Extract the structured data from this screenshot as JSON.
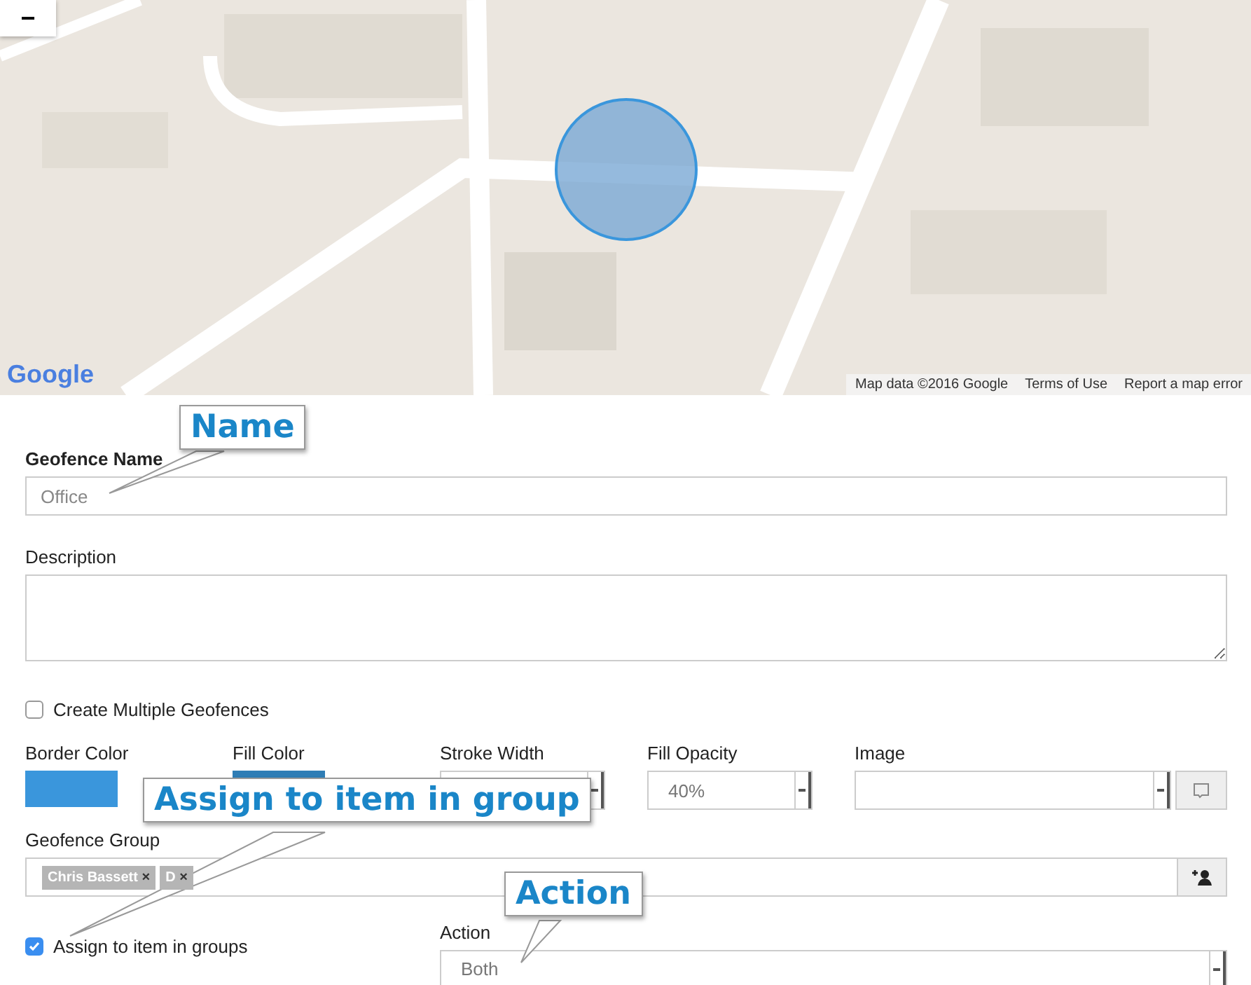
{
  "map": {
    "zoom_out": "−",
    "logo": "Google",
    "attribution": [
      "Map data ©2016 Google",
      "Terms of Use",
      "Report a map error"
    ]
  },
  "form": {
    "name": {
      "label": "Geofence Name",
      "placeholder": "Office"
    },
    "description": {
      "label": "Description"
    },
    "multiple": {
      "label": "Create Multiple Geofences",
      "checked": false
    },
    "border_color": {
      "label": "Border Color",
      "color": "#3a96dc"
    },
    "fill_color": {
      "label": "Fill Color",
      "color": "#2f7db5"
    },
    "stroke_width": {
      "label": "Stroke Width"
    },
    "fill_opacity": {
      "label": "Fill Opacity",
      "value": "40%"
    },
    "image": {
      "label": "Image"
    },
    "group": {
      "label": "Geofence Group",
      "tags": [
        {
          "label": "Chris Bassett",
          "remove": "×"
        },
        {
          "label": "D",
          "remove": "×"
        }
      ]
    },
    "assign": {
      "label": "Assign to item in groups",
      "checked": true
    },
    "action": {
      "label": "Action",
      "value": "Both"
    }
  },
  "callouts": [
    "Name",
    "Assign to item in group",
    "Action"
  ]
}
